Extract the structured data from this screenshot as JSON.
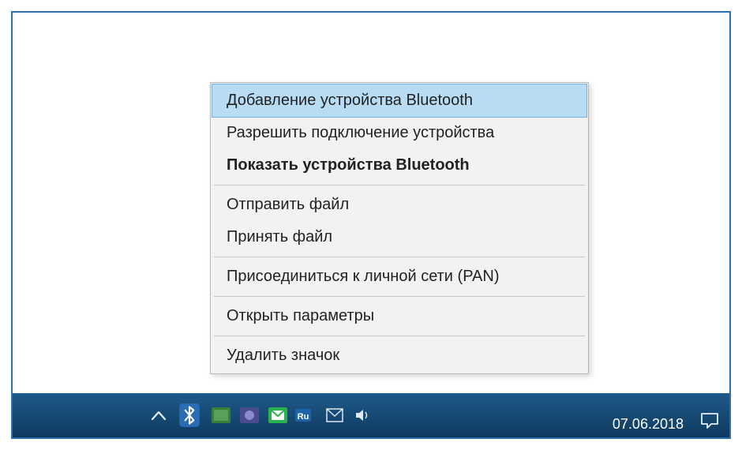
{
  "menu": {
    "items": [
      {
        "label": "Добавление устройства Bluetooth",
        "highlighted": true,
        "bold": false
      },
      {
        "label": "Разрешить подключение устройства",
        "highlighted": false,
        "bold": false
      },
      {
        "label": "Показать устройства Bluetooth",
        "highlighted": false,
        "bold": true
      },
      {
        "separator": true
      },
      {
        "label": "Отправить файл",
        "highlighted": false,
        "bold": false
      },
      {
        "label": "Принять файл",
        "highlighted": false,
        "bold": false
      },
      {
        "separator": true
      },
      {
        "label": "Присоединиться к личной сети (PAN)",
        "highlighted": false,
        "bold": false
      },
      {
        "separator": true
      },
      {
        "label": "Открыть параметры",
        "highlighted": false,
        "bold": false
      },
      {
        "separator": true
      },
      {
        "label": "Удалить значок",
        "highlighted": false,
        "bold": false
      }
    ]
  },
  "taskbar": {
    "date": "07.06.2018"
  },
  "colors": {
    "taskbar_top": "#1f5a8a",
    "taskbar_bottom": "#0f3a5f",
    "menu_highlight_bg": "#b9dcf5",
    "menu_highlight_border": "#7bb3df",
    "frame_border": "#2d6fb0"
  }
}
